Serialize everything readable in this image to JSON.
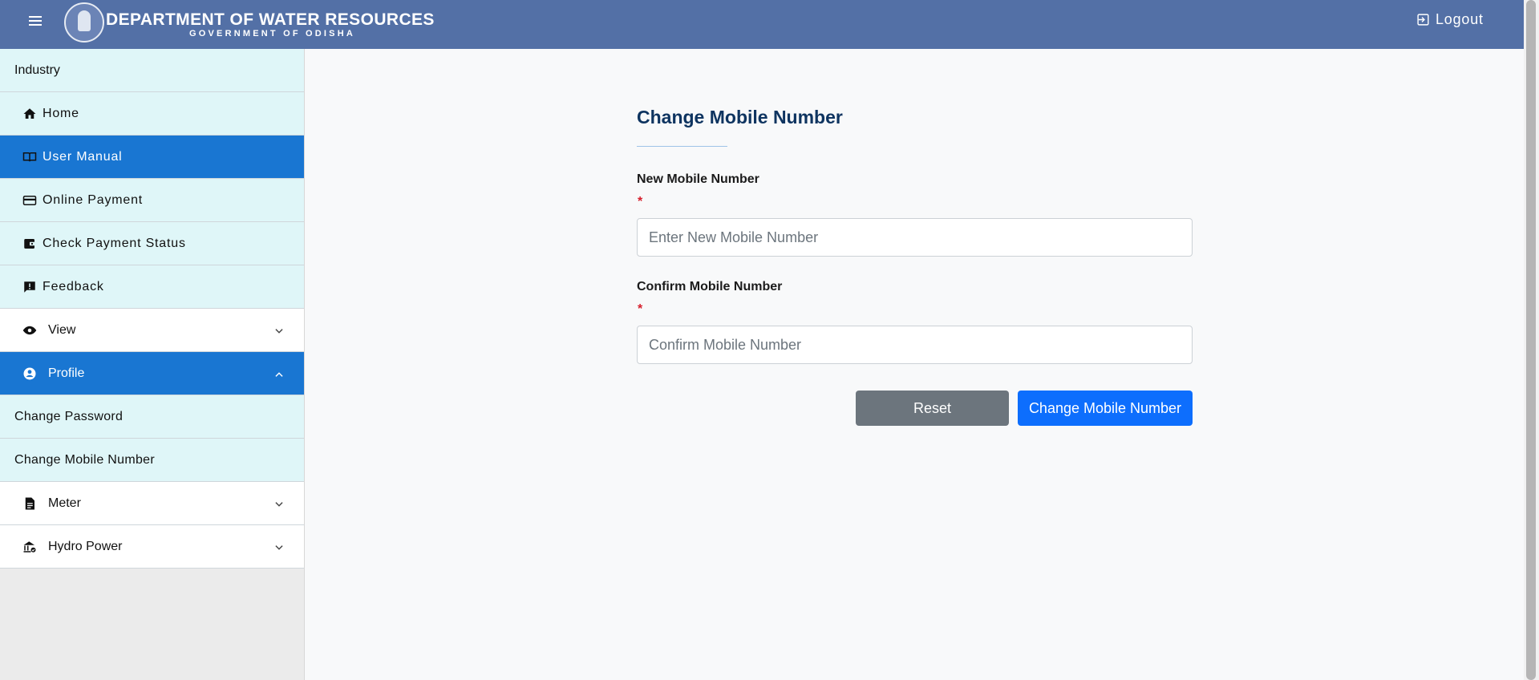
{
  "header": {
    "title": "DEPARTMENT OF WATER RESOURCES",
    "subtitle": "GOVERNMENT OF ODISHA",
    "logout_label": "Logout"
  },
  "sidebar": {
    "section_label": "Industry",
    "items": [
      {
        "label": "Home",
        "icon": "home-icon"
      },
      {
        "label": "User Manual",
        "icon": "book-icon",
        "active": true
      },
      {
        "label": "Online Payment",
        "icon": "credit-card-icon"
      },
      {
        "label": "Check Payment Status",
        "icon": "wallet-icon"
      },
      {
        "label": "Feedback",
        "icon": "feedback-icon"
      }
    ],
    "view_label": "View",
    "profile_label": "Profile",
    "profile_items": [
      "Change Password",
      "Change Mobile Number"
    ],
    "meter_label": "Meter",
    "hydro_label": "Hydro Power"
  },
  "form": {
    "title": "Change Mobile Number",
    "new_label": "New Mobile Number",
    "new_placeholder": "Enter New Mobile Number",
    "confirm_label": "Confirm Mobile Number",
    "confirm_placeholder": "Confirm Mobile Number",
    "required_mark": "*",
    "reset_label": "Reset",
    "submit_label": "Change Mobile Number"
  },
  "colors": {
    "header": "#5370a6",
    "sidebar_active": "#1976d2",
    "sidebar_light": "#dff6f8",
    "primary": "#0d6efd",
    "secondary": "#6c757d"
  }
}
